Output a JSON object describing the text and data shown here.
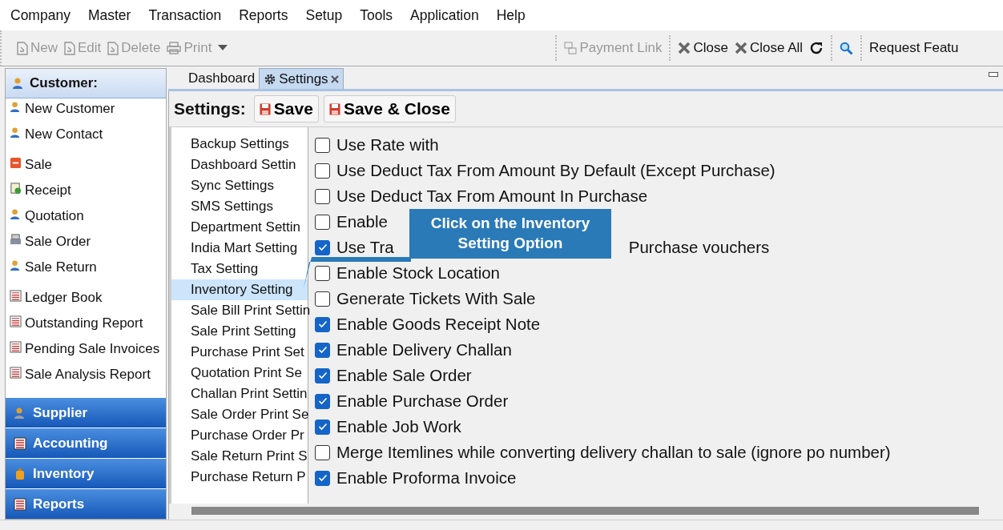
{
  "menu": [
    "Company",
    "Master",
    "Transaction",
    "Reports",
    "Setup",
    "Tools",
    "Application",
    "Help"
  ],
  "toolbar": [
    [
      {
        "kind": "new",
        "label": "New",
        "disabled": true
      },
      {
        "kind": "edit",
        "label": "Edit",
        "disabled": true
      },
      {
        "kind": "delete",
        "label": "Delete",
        "disabled": true
      },
      {
        "kind": "print",
        "label": "Print",
        "disabled": true
      },
      {
        "kind": "dropdown",
        "disabled": false
      }
    ],
    [
      {
        "kind": "payment",
        "label": "Payment Link",
        "disabled": true
      }
    ],
    [
      {
        "kind": "close",
        "label": "Close",
        "disabled": false
      },
      {
        "kind": "close",
        "label": "Close All",
        "disabled": false
      },
      {
        "kind": "refresh",
        "disabled": false
      }
    ],
    [
      {
        "kind": "search",
        "disabled": false
      }
    ],
    [
      {
        "kind": "text",
        "label": "Request Featu",
        "disabled": false
      }
    ]
  ],
  "sidebar": {
    "header": "Customer:",
    "groups": [
      [
        {
          "kind": "person",
          "label": "New Customer"
        },
        {
          "kind": "person",
          "label": "New Contact"
        }
      ],
      [
        {
          "kind": "sale",
          "label": "Sale"
        },
        {
          "kind": "receipt",
          "label": "Receipt"
        },
        {
          "kind": "person",
          "label": "Quotation"
        },
        {
          "kind": "order",
          "label": "Sale Order"
        },
        {
          "kind": "person",
          "label": "Sale Return"
        }
      ],
      [
        {
          "kind": "report",
          "label": "Ledger Book"
        },
        {
          "kind": "report",
          "label": "Outstanding Report"
        },
        {
          "kind": "report",
          "label": "Pending Sale Invoices"
        },
        {
          "kind": "report",
          "label": "Sale Analysis Report"
        }
      ]
    ],
    "sections": [
      {
        "kind": "person",
        "label": "Supplier"
      },
      {
        "kind": "report",
        "label": "Accounting"
      },
      {
        "kind": "bottle",
        "label": "Inventory"
      },
      {
        "kind": "report",
        "label": "Reports"
      }
    ]
  },
  "tabs": [
    {
      "label": "Dashboard",
      "selected": false,
      "kind": "plain"
    },
    {
      "label": "Settings",
      "selected": true,
      "kind": "settings"
    }
  ],
  "settings": {
    "title": "Settings:",
    "buttons": [
      "Save",
      "Save & Close"
    ],
    "categories": [
      {
        "label": "Backup Settings",
        "selected": false
      },
      {
        "label": "Dashboard Settin",
        "selected": false
      },
      {
        "label": "Sync Settings",
        "selected": false
      },
      {
        "label": "SMS Settings",
        "selected": false
      },
      {
        "label": "Department Settin",
        "selected": false
      },
      {
        "label": "India Mart Setting",
        "selected": false
      },
      {
        "label": "Tax Setting",
        "selected": false
      },
      {
        "label": "Inventory Setting",
        "selected": true
      },
      {
        "label": "Sale Bill Print Settin",
        "selected": false
      },
      {
        "label": "Sale Print Setting",
        "selected": false
      },
      {
        "label": "Purchase Print Set",
        "selected": false
      },
      {
        "label": "Quotation Print Se",
        "selected": false
      },
      {
        "label": "Challan Print Settin",
        "selected": false
      },
      {
        "label": "Sale Order Print Se",
        "selected": false
      },
      {
        "label": "Purchase Order Pr",
        "selected": false
      },
      {
        "label": "Sale Return Print S",
        "selected": false
      },
      {
        "label": "Purchase Return P",
        "selected": false
      }
    ],
    "options": [
      {
        "label": "Use Rate with",
        "checked": false
      },
      {
        "label": "Use Deduct Tax From Amount By Default (Except Purchase)",
        "checked": false
      },
      {
        "label": "Use Deduct Tax From Amount In Purchase",
        "checked": false
      },
      {
        "label": "Enable",
        "checked": false
      },
      {
        "label": "Use Tra",
        "label_2": "Purchase vouchers",
        "checked": true
      },
      {
        "label": "Enable Stock Location",
        "checked": false
      },
      {
        "label": "Generate Tickets With Sale",
        "checked": false
      },
      {
        "label": "Enable Goods Receipt Note",
        "checked": true
      },
      {
        "label": "Enable Delivery Challan",
        "checked": true
      },
      {
        "label": "Enable Sale Order",
        "checked": true
      },
      {
        "label": "Enable Purchase Order",
        "checked": true
      },
      {
        "label": "Enable Job Work",
        "checked": true
      },
      {
        "label": "Merge Itemlines while converting delivery challan to sale (ignore po number)",
        "checked": false
      },
      {
        "label": "Enable Proforma Invoice",
        "checked": true
      }
    ],
    "callout": "Click on the Inventory Setting Option"
  }
}
